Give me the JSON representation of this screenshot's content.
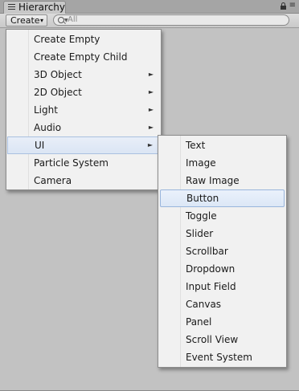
{
  "window": {
    "tab_title": "Hierarchy",
    "tab_icon": "list-icon",
    "lock_icon": "lock-icon",
    "menu_icon": "menu-dots-icon"
  },
  "toolbar": {
    "create_label": "Create",
    "create_arrow": "▾",
    "search_placeholder": "All"
  },
  "create_menu": {
    "items": [
      {
        "label": "Create Empty",
        "submenu": false
      },
      {
        "label": "Create Empty Child",
        "submenu": false
      },
      {
        "label": "3D Object",
        "submenu": true
      },
      {
        "label": "2D Object",
        "submenu": true
      },
      {
        "label": "Light",
        "submenu": true
      },
      {
        "label": "Audio",
        "submenu": true
      },
      {
        "label": "UI",
        "submenu": true,
        "open": true
      },
      {
        "label": "Particle System",
        "submenu": false
      },
      {
        "label": "Camera",
        "submenu": false
      }
    ],
    "arrow_glyph": "►"
  },
  "ui_submenu": {
    "items": [
      {
        "label": "Text"
      },
      {
        "label": "Image"
      },
      {
        "label": "Raw Image"
      },
      {
        "label": "Button",
        "highlighted": true
      },
      {
        "label": "Toggle"
      },
      {
        "label": "Slider"
      },
      {
        "label": "Scrollbar"
      },
      {
        "label": "Dropdown"
      },
      {
        "label": "Input Field"
      },
      {
        "label": "Canvas"
      },
      {
        "label": "Panel"
      },
      {
        "label": "Scroll View"
      },
      {
        "label": "Event System"
      }
    ]
  },
  "colors": {
    "panel_bg": "#c2c2c2",
    "menu_bg": "#f1f1f1",
    "highlight_border": "#99b5dc"
  }
}
